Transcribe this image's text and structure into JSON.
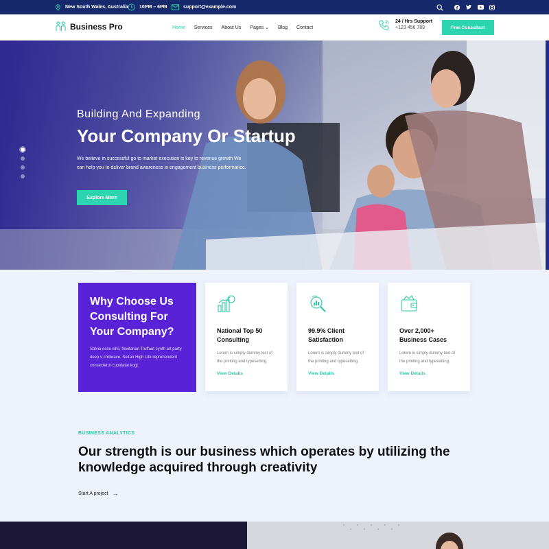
{
  "topbar": {
    "location": "New South Wales, Australia",
    "hours": "10PM – 6PM",
    "email": "support@example.com",
    "social_icons": [
      "facebook-icon",
      "twitter-icon",
      "youtube-icon",
      "instagram-icon"
    ]
  },
  "nav": {
    "brand": "Business Pro",
    "menu": [
      {
        "label": "Home",
        "active": true
      },
      {
        "label": "Services"
      },
      {
        "label": "About Us"
      },
      {
        "label": "Pages ⌄"
      },
      {
        "label": "Blog"
      },
      {
        "label": "Contact"
      }
    ],
    "support_title": "24 / Hrs Support",
    "support_phone": "+123 456 789",
    "cta": "Free Consultant"
  },
  "hero": {
    "subtitle": "Building And Expanding",
    "title": "Your Company Or Startup",
    "description": "We believe in successful go to market execution is key to revenue growth We can help you to deliver brand awareness in engagement business performance.",
    "button": "Explore More",
    "slides": 4,
    "active_slide": 1
  },
  "why": {
    "title": "Why Choose Us Consulting For Your Company?",
    "text": "Salvia esse nihil, flexitarian Truffaut synth art party deep v chillwave. Seitan High Life reprehenderit consectetur cupidatat kogi."
  },
  "cards": [
    {
      "icon": "growth-chart-icon",
      "title": "National Top 50 Consulting",
      "text": "Lorem is simply dummy text of the printing and typesetting.",
      "link": "View Details"
    },
    {
      "icon": "analytics-magnifier-icon",
      "title": "99.9% Client Satisfaction",
      "text": "Lorem is simply dummy text of the printing and typesetting.",
      "link": "View Details"
    },
    {
      "icon": "wallet-icon",
      "title": "Over 2,000+ Business Cases",
      "text": "Lorem is simply dummy text of the printing and typesetting.",
      "link": "View Details"
    }
  ],
  "analytics": {
    "label": "BUSINESS ANALYTICS",
    "title": "Our strength is our business which operates by utilizing the knowledge acquired through creativity",
    "link": "Start A project",
    "link_arrow": "→"
  },
  "colors": {
    "topbar": "#162a6b",
    "accent": "#2dd4b0",
    "purple": "#5a22d6"
  }
}
